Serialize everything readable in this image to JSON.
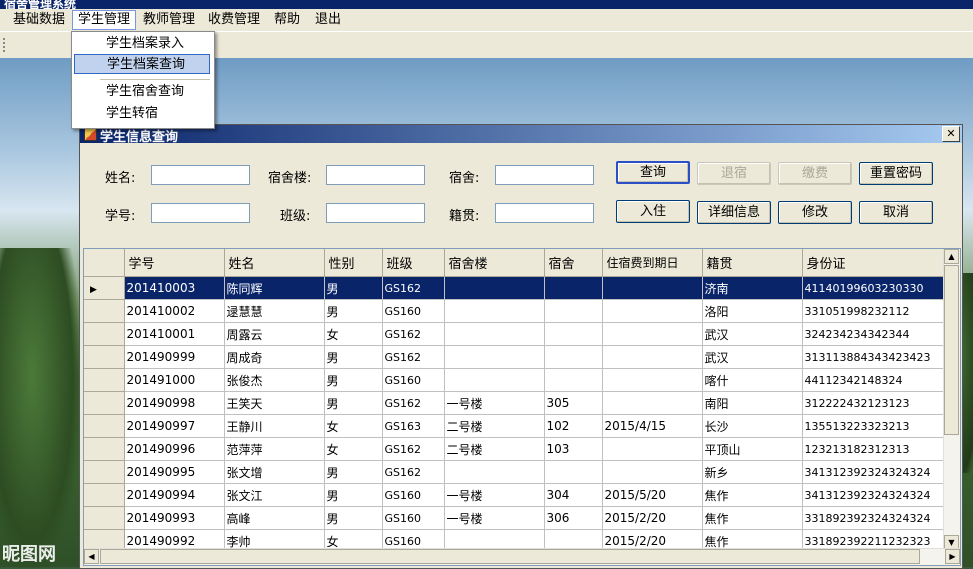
{
  "app": {
    "title": "宿舍管理系统"
  },
  "menu": [
    {
      "label": "基础数据"
    },
    {
      "label": "学生管理"
    },
    {
      "label": "教师管理"
    },
    {
      "label": "收费管理"
    },
    {
      "label": "帮助"
    },
    {
      "label": "退出"
    }
  ],
  "dropdown": [
    {
      "label": "学生档案录入"
    },
    {
      "label": "学生档案查询"
    },
    {
      "label": "学生宿舍查询"
    },
    {
      "label": "学生转宿"
    }
  ],
  "watermark": "昵图网",
  "window": {
    "title": "学生信息查询",
    "close": "✕"
  },
  "form": {
    "name_label": "姓名:",
    "dorm_building_label": "宿舍楼:",
    "dorm_label": "宿舍:",
    "student_id_label": "学号:",
    "class_label": "班级:",
    "hometown_label": "籍贯:",
    "name_value": "",
    "dorm_building_value": "",
    "dorm_value": "",
    "student_id_value": "",
    "class_value": "",
    "hometown_value": ""
  },
  "buttons": {
    "query": "查询",
    "checkout": "退宿",
    "pay": "缴费",
    "reset_password": "重置密码",
    "checkin": "入住",
    "details": "详细信息",
    "modify": "修改",
    "cancel": "取消"
  },
  "table": {
    "columns": [
      "学号",
      "姓名",
      "性别",
      "班级",
      "宿舍楼",
      "宿舍",
      "住宿费到期日",
      "籍贯",
      "身份证"
    ],
    "row_indicator": "▶",
    "rows": [
      [
        "201410003",
        "陈同辉",
        "男",
        "GS162",
        "",
        "",
        "",
        "济南",
        "41140199603230330"
      ],
      [
        "201410002",
        "逯慧慧",
        "男",
        "GS160",
        "",
        "",
        "",
        "洛阳",
        "331051998232112"
      ],
      [
        "201410001",
        "周露云",
        "女",
        "GS162",
        "",
        "",
        "",
        "武汉",
        "324234234342344"
      ],
      [
        "201490999",
        "周成奇",
        "男",
        "GS162",
        "",
        "",
        "",
        "武汉",
        "313113884343423423"
      ],
      [
        "201491000",
        "张俊杰",
        "男",
        "GS160",
        "",
        "",
        "",
        "喀什",
        "44112342148324"
      ],
      [
        "201490998",
        "王笑天",
        "男",
        "GS162",
        "一号楼",
        "305",
        "",
        "南阳",
        "312222432123123"
      ],
      [
        "201490997",
        "王静川",
        "女",
        "GS163",
        "二号楼",
        "102",
        "2015/4/15",
        "长沙",
        "135513223323213"
      ],
      [
        "201490996",
        "范萍萍",
        "女",
        "GS162",
        "二号楼",
        "103",
        "",
        "平顶山",
        "123213182312313"
      ],
      [
        "201490995",
        "张文增",
        "男",
        "GS162",
        "",
        "",
        "",
        "新乡",
        "341312392324324324"
      ],
      [
        "201490994",
        "张文江",
        "男",
        "GS160",
        "一号楼",
        "304",
        "2015/5/20",
        "焦作",
        "341312392324324324"
      ],
      [
        "201490993",
        "高峰",
        "男",
        "GS160",
        "一号楼",
        "306",
        "2015/2/20",
        "焦作",
        "331892392324324324"
      ],
      [
        "201490992",
        "李帅",
        "女",
        "GS160",
        "",
        "",
        "2015/2/20",
        "焦作",
        "331892392211232323"
      ]
    ]
  }
}
